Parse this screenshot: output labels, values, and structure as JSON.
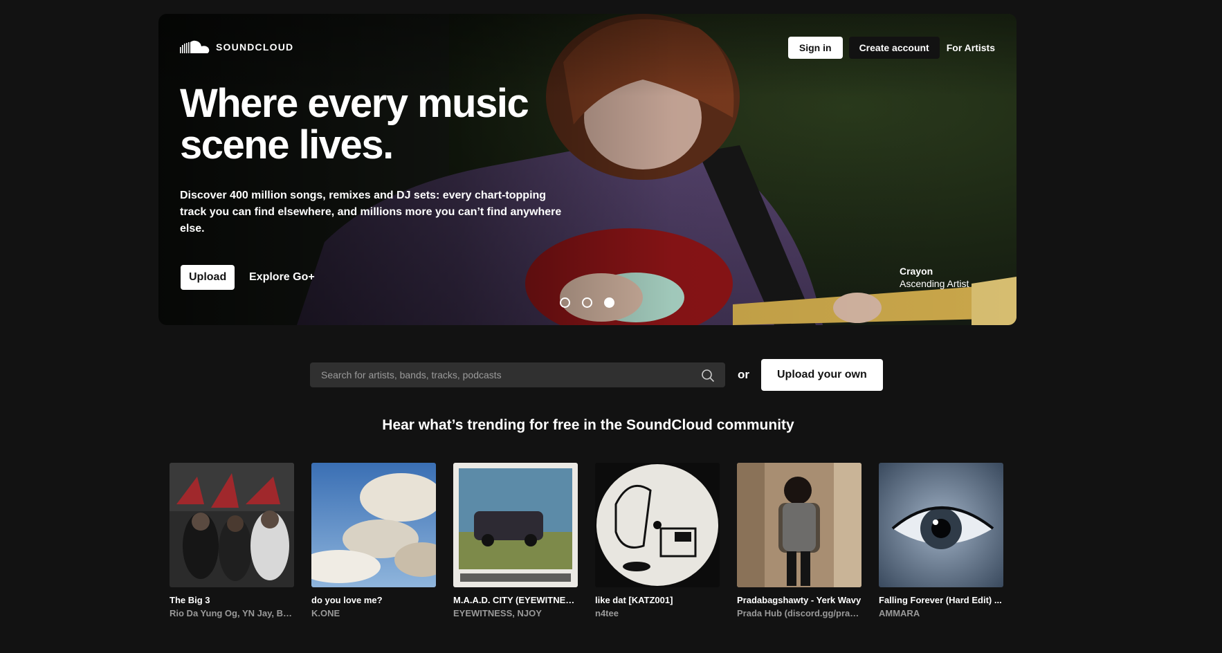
{
  "brand": {
    "name": "SOUNDCLOUD"
  },
  "header": {
    "sign_in": "Sign in",
    "create_account": "Create account",
    "for_artists": "For Artists"
  },
  "hero": {
    "title": "Where every music scene lives.",
    "subtitle": "Discover 400 million songs, remixes and DJ sets: every chart-topping track you can find elsewhere, and millions more you can’t find anywhere else.",
    "upload_label": "Upload",
    "explore_label": "Explore Go+",
    "carousel": {
      "count": 3,
      "active": 3
    },
    "credit": {
      "name": "Crayon",
      "role": "Ascending Artist"
    }
  },
  "search": {
    "placeholder": "Search for artists, bands, tracks, podcasts",
    "or_label": "or",
    "upload_own_label": "Upload your own"
  },
  "trending": {
    "heading": "Hear what’s trending for free in the SoundCloud community",
    "tracks": [
      {
        "title": "The Big 3",
        "artist": "Rio Da Yung Og, YN Jay, Babyface E"
      },
      {
        "title": "do you love me?",
        "artist": "K.ONE"
      },
      {
        "title": "M.A.A.D. CITY (EYEWITNESS X NJOY REMIX)",
        "artist": "EYEWITNESS, NJOY"
      },
      {
        "title": "like dat [KATZ001]",
        "artist": "n4tee"
      },
      {
        "title": "Pradabagshawty - Yerk Wavy",
        "artist": "Prada Hub (discord.gg/prada)"
      },
      {
        "title": "Falling Forever (Hard Edit) ...",
        "artist": "AMMARA"
      }
    ]
  },
  "colors": {
    "background": "#121212",
    "search_bg": "#303030",
    "muted_text": "#999999",
    "button_light": "#ffffff"
  }
}
